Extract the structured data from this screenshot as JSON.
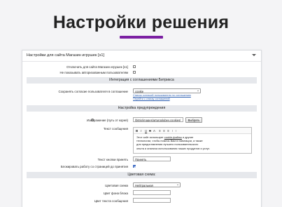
{
  "hero": {
    "title": "Настройки решения"
  },
  "colors": {
    "accent": "#7b1fa2",
    "section_bg": "#e6e8ec",
    "link": "#2a5db0"
  },
  "panel": {
    "title": "Настройки для сайта Магазин игрушек [s1]",
    "disable_label": "Отключить для сайта Магазин игрушек [s1]",
    "no_auth_label": "Не показывать авторизованным пользователям",
    "section_bitrix": "Интеграция с соглашениями Битрикса",
    "save_agreement_label": "Сохранять согласие пользователя в соглашение",
    "agreement_value": "cookie",
    "link_create": "Список согласий пользователя по соглашению",
    "link_list": "Перейти к списку соглашений",
    "section_warning": "Настройка предупреждения",
    "image_label": "Изображение (путь от корня)",
    "image_path": "/bitrix/images/arturgolubev.cookies/",
    "choose_button": "Выбрать",
    "message_label": "Текст сообщения",
    "toolbar": {
      "b": "B",
      "i": "I",
      "u": "U",
      "s": "S",
      "a": "A",
      "c1": "≡",
      "c2": "≡",
      "c3": "≡",
      "c4": "⁝",
      "c5": "⁝"
    },
    "message_lines": [
      "Этот сайт использует cookie-файлы и другие",
      "технологии, чтобы помочь Вам в навигации, а также",
      "для предоставления лучшего пользовательского",
      "опыта и анализа использования наших продуктов и услуг."
    ],
    "message_underlined": "cookie-файлы",
    "accept_label": "Текст кнопки принять",
    "accept_value": "Принять",
    "block_label": "Блокировать работу со страницей до принятия",
    "section_colors": "Цветовая схема:",
    "scheme_label": "Цветовая схема",
    "scheme_value": "Нейтральная",
    "bg_color_label": "Цвет фона блока",
    "text_color_label": "Цвет текста сообщения"
  }
}
